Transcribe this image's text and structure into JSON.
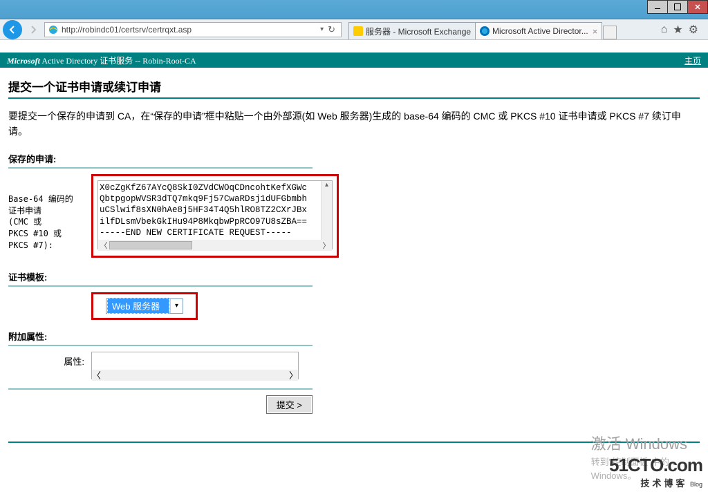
{
  "window": {
    "url": "http://robindc01/certsrv/certrqxt.asp",
    "tab1_label": "服务器 - Microsoft Exchange",
    "tab2_label": "Microsoft Active Director..."
  },
  "banner": {
    "brand": "Microsoft",
    "service": " Active Directory 证书服务  --  Robin-Root-CA",
    "home_link": "主页"
  },
  "page": {
    "heading": "提交一个证书申请或续订申请",
    "description": "要提交一个保存的申请到 CA，在“保存的申请”框中粘贴一个由外部源(如 Web 服务器)生成的 base-64 编码的 CMC 或 PKCS #10 证书申请或 PKCS #7 续订申请。",
    "section_saved": "保存的申请:",
    "side_label": "Base-64 编码的\n证书申请\n(CMC 或\nPKCS #10 或\nPKCS #7):",
    "cert_text": "X0cZgKfZ67AYcQ8SkI0ZVdCWOqCDncohtKefXGWc\nQbtpgopWVSR3dTQ7mkq9Fj57CwaRDsj1dUFGbmbh\nuCSlwif8sXN0hAe8j5HF34T4Q5hlRO8TZ2CXrJBx\nilfDLsmVbekGkIHu94P8MkqbwPpRCO97U8sZBA==\n-----END NEW CERTIFICATE REQUEST-----",
    "section_template": "证书模板:",
    "template_value": "Web 服务器",
    "section_attr": "附加属性:",
    "attr_label": "属性:",
    "submit_label": "提交 >"
  },
  "watermark": {
    "title": "激活 Windows",
    "line": "转到\"控制面板\"中的…",
    "line2": "Windows。"
  },
  "logo": {
    "main": "51CTO.com",
    "sub": "技术博客",
    "blog": "Blog"
  }
}
